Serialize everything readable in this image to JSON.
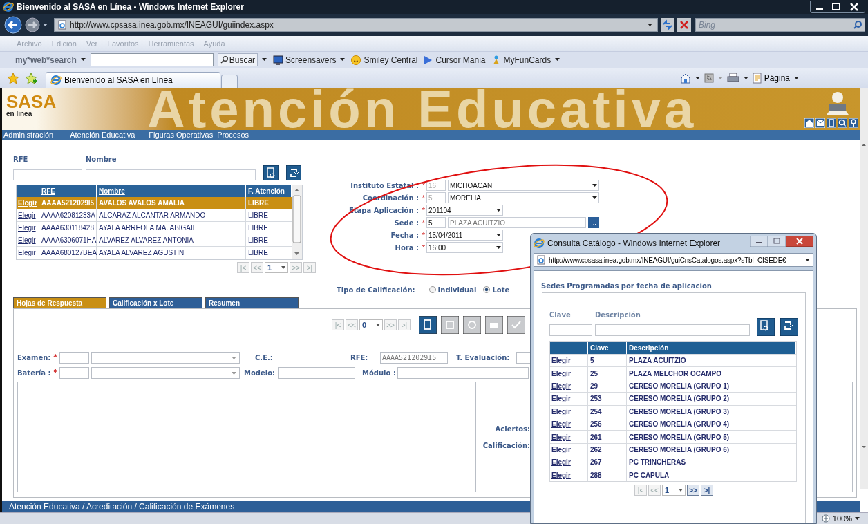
{
  "browser": {
    "title": "Bienvenido al SASA en Línea - Windows Internet Explorer",
    "url": "http://www.cpsasa.inea.gob.mx/INEAGUI/guiindex.aspx",
    "search_placeholder": "Bing",
    "menu": [
      "Archivo",
      "Edición",
      "Ver",
      "Favoritos",
      "Herramientas",
      "Ayuda"
    ],
    "toolbar_brand": "my*web*search",
    "search_button": "Buscar",
    "links": [
      "Screensavers",
      "Smiley Central",
      "Cursor Mania",
      "MyFunCards"
    ],
    "tab": "Bienvenido al SASA en Línea",
    "page_menu": "Página",
    "zoom": "100%"
  },
  "app": {
    "logo": "SASA",
    "logo_sub": "en línea",
    "banner": "Atención Educativa",
    "menu": [
      "Administración",
      "Atención Educativa",
      "Figuras Operativas",
      "Procesos"
    ],
    "filter_labels": [
      "RFE",
      "Nombre"
    ],
    "grid": {
      "columns": [
        "RFE",
        "Nombre",
        "F. Atención"
      ],
      "rows": [
        {
          "action": "Elegir",
          "rfe": "AAAA5212029I5",
          "name": "AVALOS AVALOS AMALIA",
          "status": "LIBRE",
          "selected": true
        },
        {
          "action": "Elegir",
          "rfe": "AAAA62081233A",
          "name": "ALCARAZ ALCANTAR ARMANDO",
          "status": "LIBRE",
          "selected": false
        },
        {
          "action": "Elegir",
          "rfe": "AAAA630118428",
          "name": "AYALA ARREOLA MA. ABIGAIL",
          "status": "LIBRE",
          "selected": false
        },
        {
          "action": "Elegir",
          "rfe": "AAAA6306071HA",
          "name": "ALVAREZ ALVAREZ ANTONIA",
          "status": "LIBRE",
          "selected": false
        },
        {
          "action": "Elegir",
          "rfe": "AAAA680127BEA",
          "name": "AYALA ALVAREZ AGUSTIN",
          "status": "LIBRE",
          "selected": false
        }
      ]
    },
    "grid_pager": {
      "buttons": [
        {
          "label": "|<",
          "disabled": true
        },
        {
          "label": "<<",
          "disabled": true
        },
        {
          "label": ">>",
          "disabled": true
        },
        {
          "label": ">|",
          "disabled": true
        }
      ],
      "page": "1"
    },
    "form": [
      {
        "kind": "combo",
        "label": "Instituto Estatal :",
        "mark": "*",
        "code": "16",
        "code_disabled": true,
        "value": "MICHOACAN"
      },
      {
        "kind": "combo",
        "label": "Coordinación :",
        "mark": "*",
        "code": "5",
        "code_disabled": true,
        "value": "MORELIA"
      },
      {
        "kind": "select",
        "label": "Etapa Aplicación :",
        "mark": "*",
        "value": "201104"
      },
      {
        "kind": "lookup",
        "label": "Sede :",
        "mark": "*",
        "code": "5",
        "code_disabled": false,
        "value": "PLAZA ACUITZIO",
        "value_disabled": true,
        "button": "..."
      },
      {
        "kind": "select",
        "label": "Fecha :",
        "mark": "*",
        "value": "15/04/2011"
      },
      {
        "kind": "select",
        "label": "Hora :",
        "mark": "*",
        "value": "16:00"
      }
    ],
    "grading": {
      "label": "Tipo de Calificación:",
      "options": [
        {
          "label": "Individual",
          "selected": false
        },
        {
          "label": "Lote",
          "selected": true
        }
      ]
    },
    "tabs": [
      {
        "label": "Hojas de Respuesta",
        "selected": true
      },
      {
        "label": "Calificación x Lote",
        "selected": false
      },
      {
        "label": "Resumen",
        "selected": false
      }
    ],
    "panel": {
      "pager": {
        "buttons": [
          {
            "label": "|<",
            "disabled": true
          },
          {
            "label": "<<",
            "disabled": true
          },
          {
            "label": ">>",
            "disabled": true
          },
          {
            "label": ">|",
            "disabled": true
          }
        ],
        "page": "0"
      },
      "actions": [
        {
          "disabled": false
        },
        {
          "disabled": true
        },
        {
          "disabled": true
        },
        {
          "disabled": true
        },
        {
          "disabled": true
        }
      ],
      "rows": [
        [
          {
            "kind": "combo",
            "label": "Examen:",
            "mark": "*"
          },
          {
            "kind": "label",
            "label": "C.E.:"
          },
          {
            "kind": "text",
            "label": "RFE:",
            "value": "AAAA5212029I5",
            "disabled": true
          },
          {
            "kind": "text",
            "label": "T. Evaluación:"
          }
        ],
        [
          {
            "kind": "combo",
            "label": "Batería :",
            "mark": "*"
          },
          {
            "kind": "text",
            "label": "Modelo:"
          },
          {
            "kind": "text",
            "label": "Módulo :"
          }
        ]
      ],
      "result_labels": [
        "Aciertos:",
        "Calificación:"
      ]
    },
    "breadcrumb": "Atención Educativa / Acreditación / Calificación de Exámenes"
  },
  "popup": {
    "title": "Consulta Catálogo - Windows Internet Explorer",
    "url": "http://www.cpsasa.inea.gob.mx/INEAGUI/guiCnsCatalogos.aspx?sTbl=CISEDE€",
    "heading": "Sedes Programadas por fecha de aplicacion",
    "filter_labels": [
      "Clave",
      "Descripción"
    ],
    "columns": [
      "Clave",
      "Descripción"
    ],
    "rows": [
      {
        "action": "Elegir",
        "code": "5",
        "description": "PLAZA ACUITZIO"
      },
      {
        "action": "Elegir",
        "code": "25",
        "description": "PLAZA MELCHOR OCAMPO"
      },
      {
        "action": "Elegir",
        "code": "29",
        "description": "CERESO MORELIA (GRUPO 1)"
      },
      {
        "action": "Elegir",
        "code": "253",
        "description": "CERESO MORELIA (GRUPO 2)"
      },
      {
        "action": "Elegir",
        "code": "254",
        "description": "CERESO MORELIA (GRUPO 3)"
      },
      {
        "action": "Elegir",
        "code": "256",
        "description": "CERESO MORELIA (GRUPO 4)"
      },
      {
        "action": "Elegir",
        "code": "261",
        "description": "CERESO MORELIA (GRUPO 5)"
      },
      {
        "action": "Elegir",
        "code": "262",
        "description": "CERESO MORELIA (GRUPO 6)"
      },
      {
        "action": "Elegir",
        "code": "267",
        "description": "PC TRINCHERAS"
      },
      {
        "action": "Elegir",
        "code": "288",
        "description": "PC CAPULA"
      }
    ],
    "pager": {
      "buttons": [
        {
          "label": "|<",
          "disabled": true
        },
        {
          "label": "<<",
          "disabled": true
        },
        {
          "label": ">>",
          "disabled": false
        },
        {
          "label": ">|",
          "disabled": false
        }
      ],
      "page": "1"
    }
  }
}
